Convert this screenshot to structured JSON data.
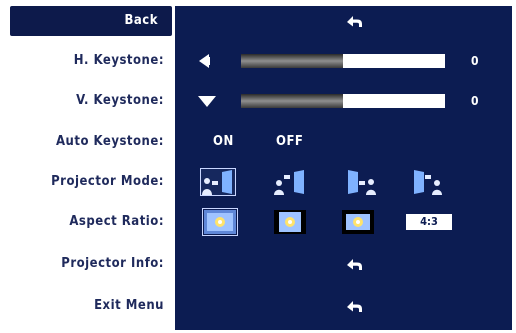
{
  "menu": {
    "items": [
      {
        "label": "Back"
      },
      {
        "label": "H. Keystone:"
      },
      {
        "label": "V. Keystone:"
      },
      {
        "label": "Auto Keystone:"
      },
      {
        "label": "Projector Mode:"
      },
      {
        "label": "Aspect Ratio:"
      },
      {
        "label": "Projector Info:"
      },
      {
        "label": "Exit Menu"
      }
    ]
  },
  "settings": {
    "h_keystone": {
      "value": "0",
      "level": 0.5
    },
    "v_keystone": {
      "value": "0",
      "level": 0.5
    },
    "auto_keystone": {
      "on_label": "ON",
      "off_label": "OFF"
    },
    "projector_mode": {
      "options": [
        "front-projection",
        "front-ceiling",
        "rear-projection",
        "rear-ceiling"
      ],
      "selected": 0
    },
    "aspect_ratio": {
      "options": [
        "original",
        "16:9",
        "4:3-icon",
        "4:3"
      ],
      "text_option": "4:3",
      "selected": 0
    }
  },
  "colors": {
    "panel": "#0c1c52",
    "label_text": "#1f2a5c",
    "selected_label_bg": "#0d1a4b",
    "slider_fill": "#5f5f5f"
  },
  "icons": {
    "enter": "enter-return-icon",
    "h_keystone": "triangle-left-icon",
    "v_keystone": "triangle-down-icon"
  }
}
